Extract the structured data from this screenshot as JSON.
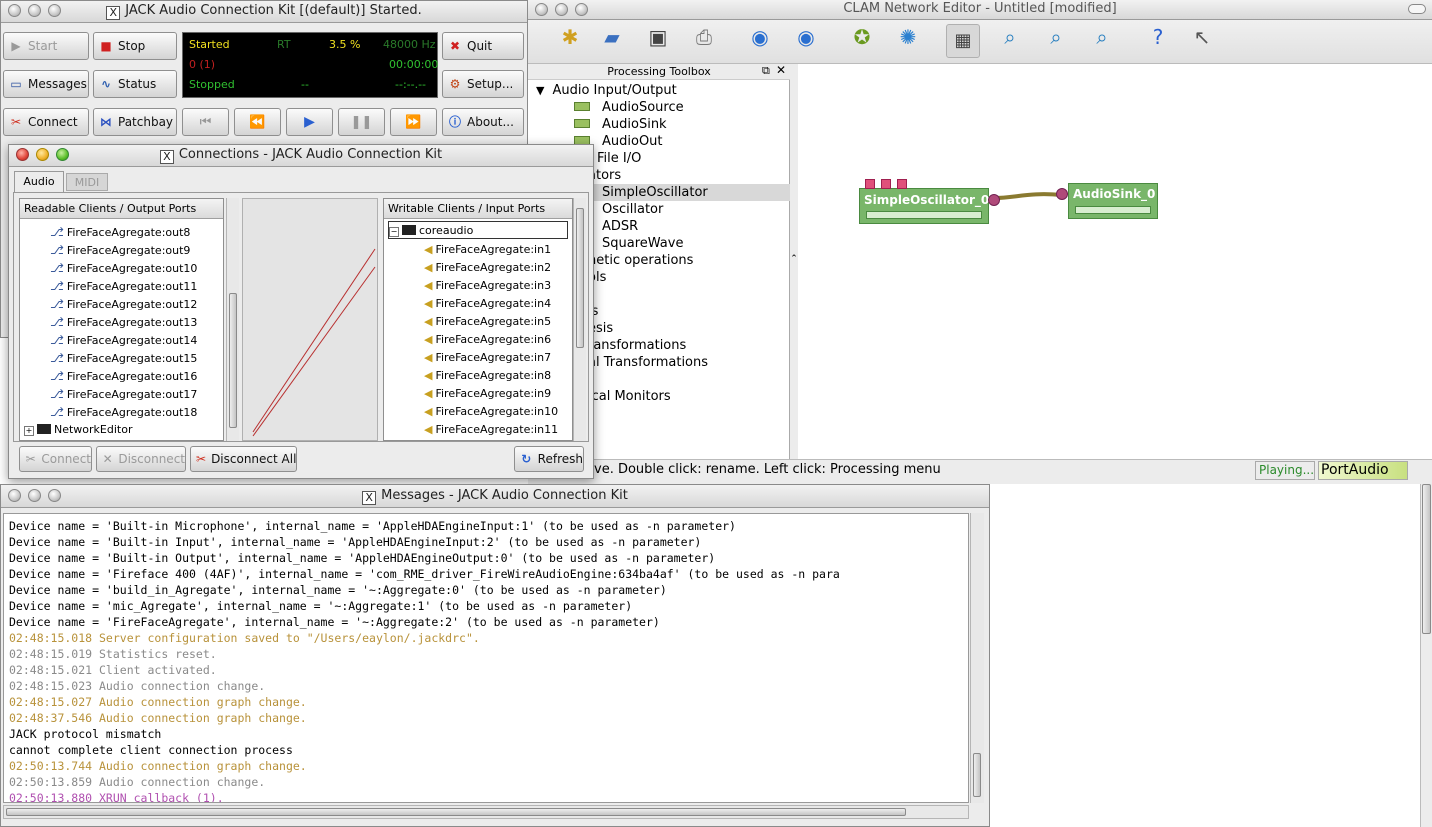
{
  "jack": {
    "title": "JACK Audio Connection Kit [(default)] Started.",
    "buttons": {
      "start": "Start",
      "stop": "Stop",
      "quit": "Quit",
      "messages": "Messages",
      "status": "Status",
      "setup": "Setup...",
      "connect": "Connect",
      "patchbay": "Patchbay",
      "about": "About..."
    },
    "display": {
      "state": "Started",
      "rt": "RT",
      "dsp": "3.5 %",
      "rate": "48000 Hz",
      "xruns": "0 (1)",
      "time": "00:00:00",
      "stopped": "Stopped",
      "dash1": "--",
      "dash2": "--:--.--"
    }
  },
  "connections": {
    "title": "Connections - JACK Audio Connection Kit",
    "tabs": [
      "Audio",
      "MIDI"
    ],
    "readable_header": "Readable Clients / Output Ports",
    "writable_header": "Writable Clients / Input Ports",
    "readable_ports": [
      "FireFaceAgregate:out8",
      "FireFaceAgregate:out9",
      "FireFaceAgregate:out10",
      "FireFaceAgregate:out11",
      "FireFaceAgregate:out12",
      "FireFaceAgregate:out13",
      "FireFaceAgregate:out14",
      "FireFaceAgregate:out15",
      "FireFaceAgregate:out16",
      "FireFaceAgregate:out17",
      "FireFaceAgregate:out18"
    ],
    "readable_client": "NetworkEditor",
    "writable_client": "coreaudio",
    "writable_ports": [
      "FireFaceAgregate:in1",
      "FireFaceAgregate:in2",
      "FireFaceAgregate:in3",
      "FireFaceAgregate:in4",
      "FireFaceAgregate:in5",
      "FireFaceAgregate:in6",
      "FireFaceAgregate:in7",
      "FireFaceAgregate:in8",
      "FireFaceAgregate:in9",
      "FireFaceAgregate:in10",
      "FireFaceAgregate:in11"
    ],
    "buttons": {
      "connect": "Connect",
      "disconnect": "Disconnect",
      "disconnect_all": "Disconnect All",
      "refresh": "Refresh"
    }
  },
  "clam": {
    "title": "CLAM Network Editor - Untitled [modified]",
    "toolbox_title": "Processing Toolbox",
    "toolbox_items": [
      "Audio Input/Output",
      "AudioSource",
      "AudioSink",
      "AudioOut",
      "File I/O",
      "ators",
      "SimpleOscillator",
      "Oscillator",
      "ADSR",
      "SquareWave",
      "hetic operations",
      "ols",
      "is",
      "esis",
      "ransformations",
      "al Transformations",
      "ical Monitors"
    ],
    "nodes": {
      "osc": "SimpleOscillator_0",
      "sink": "AudioSink_0"
    },
    "status": "ve. Double click: rename. Left click: Processing menu",
    "playing": "Playing...",
    "backend": "PortAudio"
  },
  "messages": {
    "title": "Messages - JACK Audio Connection Kit",
    "lines": [
      {
        "t": "Device name = 'Built-in Microphone', internal_name = 'AppleHDAEngineInput:1' (to be used as -n parameter)",
        "c": "#000000"
      },
      {
        "t": "Device name = 'Built-in Input', internal_name = 'AppleHDAEngineInput:2' (to be used as -n parameter)",
        "c": "#000000"
      },
      {
        "t": "Device name = 'Built-in Output', internal_name = 'AppleHDAEngineOutput:0' (to be used as -n parameter)",
        "c": "#000000"
      },
      {
        "t": "Device name = 'Fireface 400 (4AF)', internal_name = 'com_RME_driver_FireWireAudioEngine:634ba4af' (to be used as -n para",
        "c": "#000000"
      },
      {
        "t": "Device name = 'build_in_Agregate', internal_name = '~:Aggregate:0' (to be used as -n parameter)",
        "c": "#000000"
      },
      {
        "t": "Device name = 'mic_Agregate', internal_name = '~:Aggregate:1' (to be used as -n parameter)",
        "c": "#000000"
      },
      {
        "t": "Device name = 'FireFaceAgregate', internal_name = '~:Aggregate:2' (to be used as -n parameter)",
        "c": "#000000"
      },
      {
        "t": "02:48:15.018 Server configuration saved to \"/Users/eaylon/.jackdrc\".",
        "c": "#b8923a"
      },
      {
        "t": "02:48:15.019 Statistics reset.",
        "c": "#8a8a8a"
      },
      {
        "t": "02:48:15.021 Client activated.",
        "c": "#8a8a8a"
      },
      {
        "t": "02:48:15.023 Audio connection change.",
        "c": "#8a8a8a"
      },
      {
        "t": "02:48:15.027 Audio connection graph change.",
        "c": "#b8923a"
      },
      {
        "t": "02:48:37.546 Audio connection graph change.",
        "c": "#b8923a"
      },
      {
        "t": "JACK protocol mismatch",
        "c": "#000000"
      },
      {
        "t": "cannot complete client connection process",
        "c": "#000000"
      },
      {
        "t": "02:50:13.744 Audio connection graph change.",
        "c": "#b8923a"
      },
      {
        "t": "02:50:13.859 Audio connection change.",
        "c": "#8a8a8a"
      },
      {
        "t": "02:50:13.880 XRUN callback (1).",
        "c": "#b050b0"
      }
    ]
  }
}
